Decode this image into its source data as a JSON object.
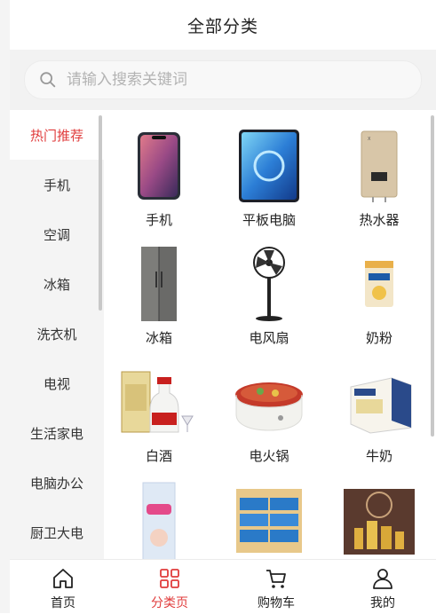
{
  "header": {
    "title": "全部分类"
  },
  "search": {
    "placeholder": "请输入搜索关键词"
  },
  "sidebar": {
    "items": [
      {
        "label": "热门推荐",
        "active": true
      },
      {
        "label": "手机"
      },
      {
        "label": "空调"
      },
      {
        "label": "冰箱"
      },
      {
        "label": "洗衣机"
      },
      {
        "label": "电视"
      },
      {
        "label": "生活家电"
      },
      {
        "label": "电脑办公"
      },
      {
        "label": "厨卫大电"
      }
    ]
  },
  "products": [
    {
      "label": "手机",
      "icon": "phone-image"
    },
    {
      "label": "平板电脑",
      "icon": "tablet-image"
    },
    {
      "label": "热水器",
      "icon": "water-heater-image"
    },
    {
      "label": "冰箱",
      "icon": "fridge-image"
    },
    {
      "label": "电风扇",
      "icon": "fan-image"
    },
    {
      "label": "奶粉",
      "icon": "milk-powder-image"
    },
    {
      "label": "白酒",
      "icon": "liquor-image"
    },
    {
      "label": "电火锅",
      "icon": "hotpot-image"
    },
    {
      "label": "牛奶",
      "icon": "milk-image"
    },
    {
      "label": "",
      "icon": "diapers-image"
    },
    {
      "label": "",
      "icon": "tissue-image"
    },
    {
      "label": "",
      "icon": "cosmetics-image"
    }
  ],
  "tabbar": {
    "items": [
      {
        "label": "首页",
        "icon": "home-icon"
      },
      {
        "label": "分类页",
        "icon": "category-icon",
        "active": true
      },
      {
        "label": "购物车",
        "icon": "cart-icon"
      },
      {
        "label": "我的",
        "icon": "user-icon"
      }
    ]
  },
  "colors": {
    "accent": "#e03c3c",
    "sidebar_bg": "#f4f4f4",
    "text": "#222222"
  }
}
